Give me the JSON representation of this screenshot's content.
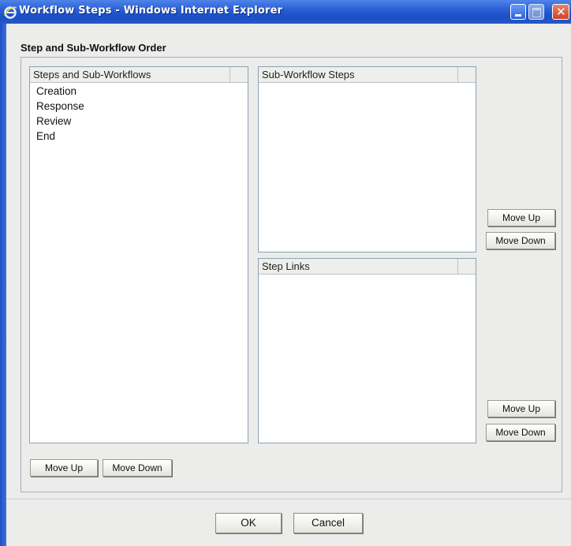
{
  "window": {
    "title": "Workflow Steps - Windows Internet Explorer"
  },
  "group": {
    "title": "Step and Sub-Workflow Order"
  },
  "steps_list": {
    "header": "Steps and Sub-Workflows",
    "items": [
      "Creation",
      "Response",
      "Review",
      "End"
    ]
  },
  "subworkflow_list": {
    "header": "Sub-Workflow Steps",
    "items": []
  },
  "step_links_list": {
    "header": "Step Links",
    "items": []
  },
  "buttons": {
    "move_up": "Move Up",
    "move_down": "Move Down",
    "ok": "OK",
    "cancel": "Cancel"
  },
  "colors": {
    "titlebar": "#2a5fd6",
    "background": "#ececea"
  }
}
